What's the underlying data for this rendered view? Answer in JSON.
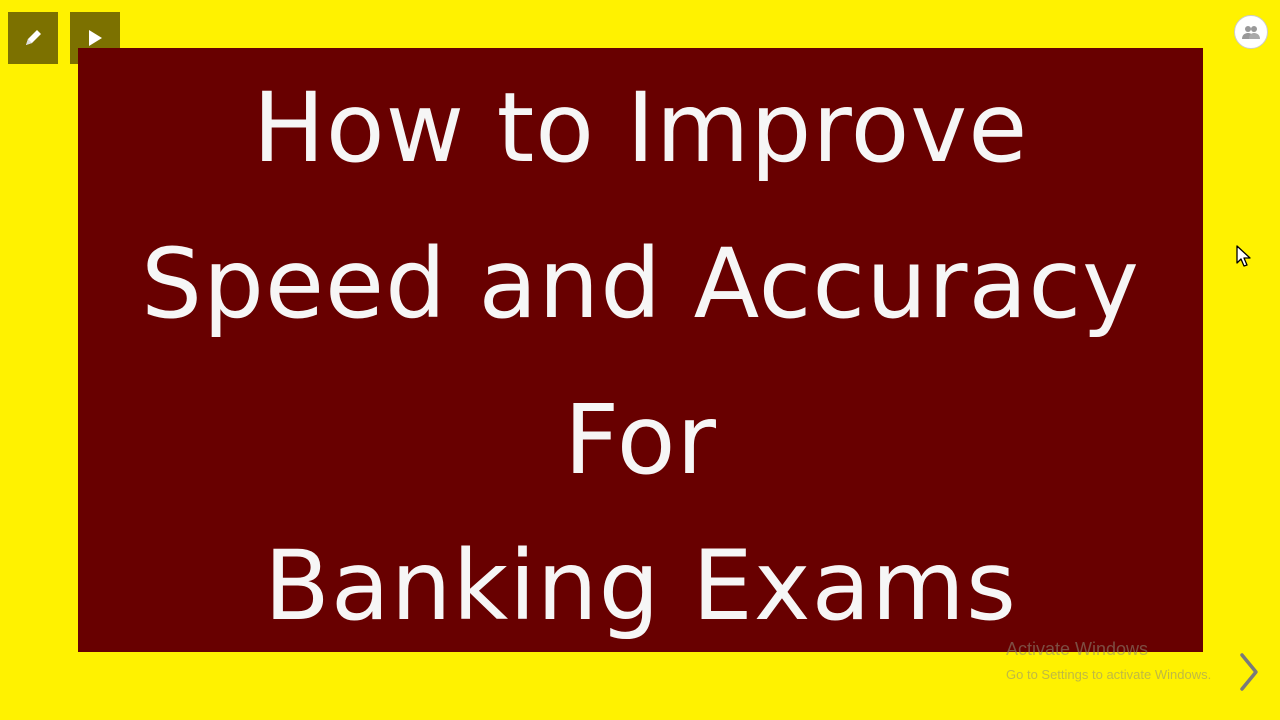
{
  "slide": {
    "title_lines": [
      "How to Improve",
      "Speed and Accuracy",
      "For",
      "Banking Exams"
    ],
    "background_color": "#fff200",
    "box_color": "#680000",
    "text_color": "#f6f6f6"
  },
  "toolbar": {
    "pen_icon": "pencil-icon",
    "play_icon": "play-icon"
  },
  "top_right": {
    "icon": "people-icon"
  },
  "watermark": {
    "title": "Activate Windows",
    "subtitle": "Go to Settings to activate Windows."
  },
  "navigation": {
    "next_icon": "chevron-right-icon"
  }
}
